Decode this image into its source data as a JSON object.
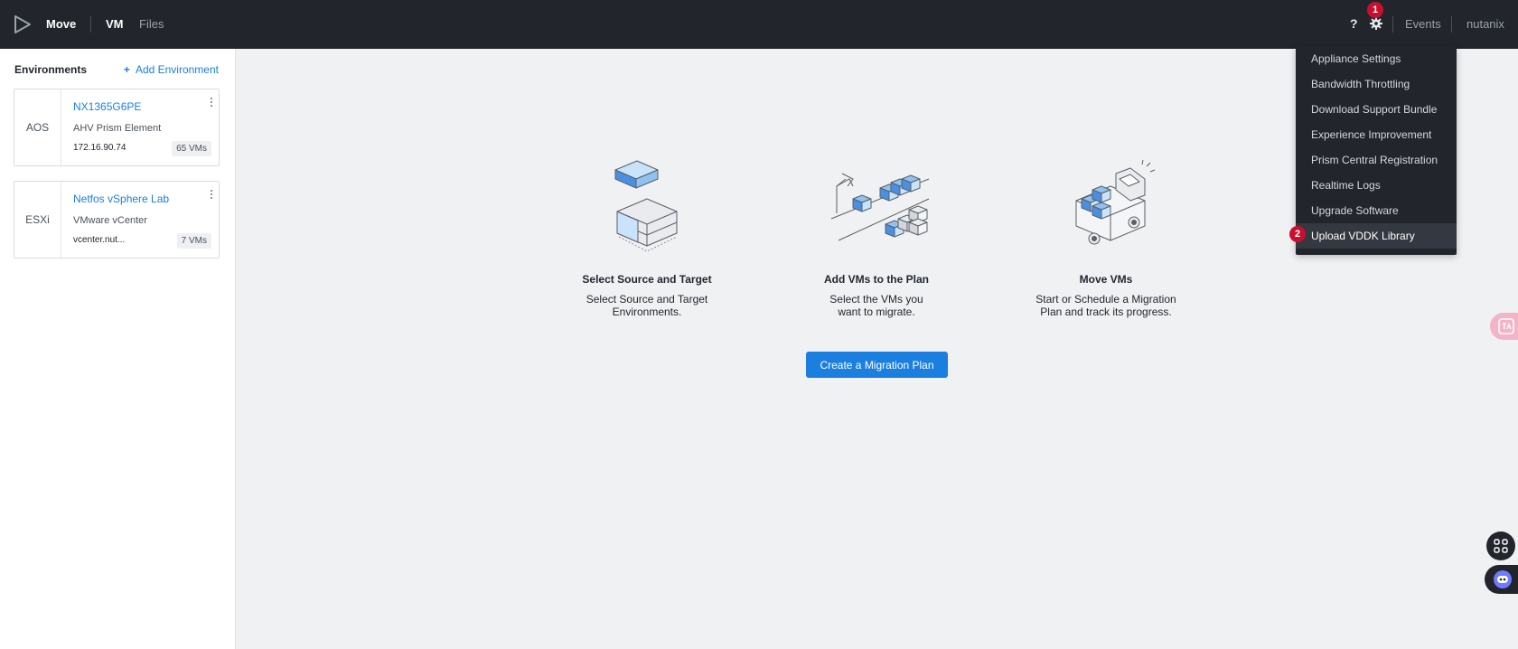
{
  "topbar": {
    "app_name": "Move",
    "nav": [
      "VM",
      "Files"
    ],
    "help_label": "?",
    "settings_badge": "1",
    "events_label": "Events",
    "user_label": "nutanix"
  },
  "sidebar": {
    "title": "Environments",
    "add_plus": "+",
    "add_label": "Add Environment",
    "environments": [
      {
        "type": "AOS",
        "name": "NX1365G6PE",
        "subtype": "AHV Prism Element",
        "address": "172.16.90.74",
        "vm_count": "65 VMs"
      },
      {
        "type": "ESXi",
        "name": "Netfos vSphere Lab",
        "subtype": "VMware vCenter",
        "address": "vcenter.nut...",
        "vm_count": "7 VMs"
      }
    ]
  },
  "steps": [
    {
      "title": "Select Source and Target",
      "desc_1": "Select Source and Target",
      "desc_2": "Environments."
    },
    {
      "title": "Add VMs to the Plan",
      "desc_1": "Select the VMs you",
      "desc_2": "want to migrate."
    },
    {
      "title": "Move VMs",
      "desc_1": "Start or Schedule a Migration",
      "desc_2": "Plan and track its progress."
    }
  ],
  "cta_label": "Create a Migration Plan",
  "settings_menu": {
    "items": [
      "Appliance Settings",
      "Bandwidth Throttling",
      "Download Support Bundle",
      "Experience Improvement",
      "Prism Central Registration",
      "Realtime Logs",
      "Upgrade Software",
      "Upload VDDK Library"
    ],
    "highlight_badge": "2"
  },
  "colors": {
    "topbar": "#22252b",
    "accent": "#1b7fe0",
    "badge": "#c8102e"
  },
  "icons": [
    "move-logo-icon",
    "gear-icon",
    "kebab-icon",
    "translate-icon",
    "apps-icon",
    "assistant-icon"
  ]
}
